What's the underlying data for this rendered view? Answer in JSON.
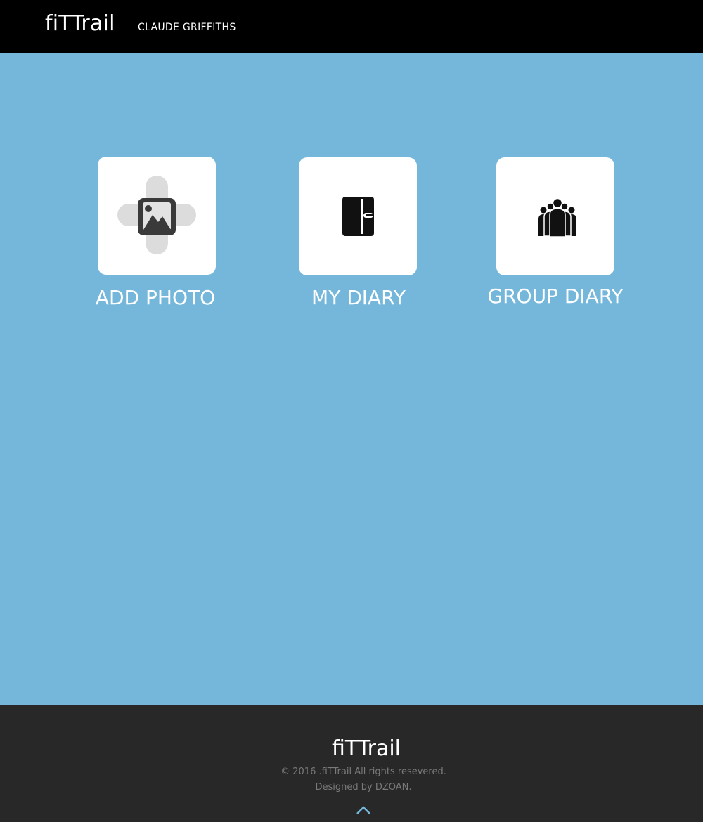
{
  "header": {
    "brand": "fiTTrail",
    "user_name": "CLAUDE GRIFFITHS"
  },
  "tiles": [
    {
      "label": "ADD PHOTO",
      "icon": "add-photo-icon"
    },
    {
      "label": "MY DIARY",
      "icon": "diary-icon"
    },
    {
      "label": "GROUP DIARY",
      "icon": "group-icon"
    }
  ],
  "footer": {
    "brand": "fiTTrail",
    "copyright": "© 2016 .fiTTrail All rights resevered.",
    "designed_by_prefix": "Designed by ",
    "designer": "DZOAN",
    "designed_by_suffix": ".",
    "back_to_top_icon": "chevron-up-icon"
  },
  "colors": {
    "header_bg": "#000000",
    "main_bg": "#75b7db",
    "footer_bg": "#282828",
    "accent": "#75b7db"
  }
}
